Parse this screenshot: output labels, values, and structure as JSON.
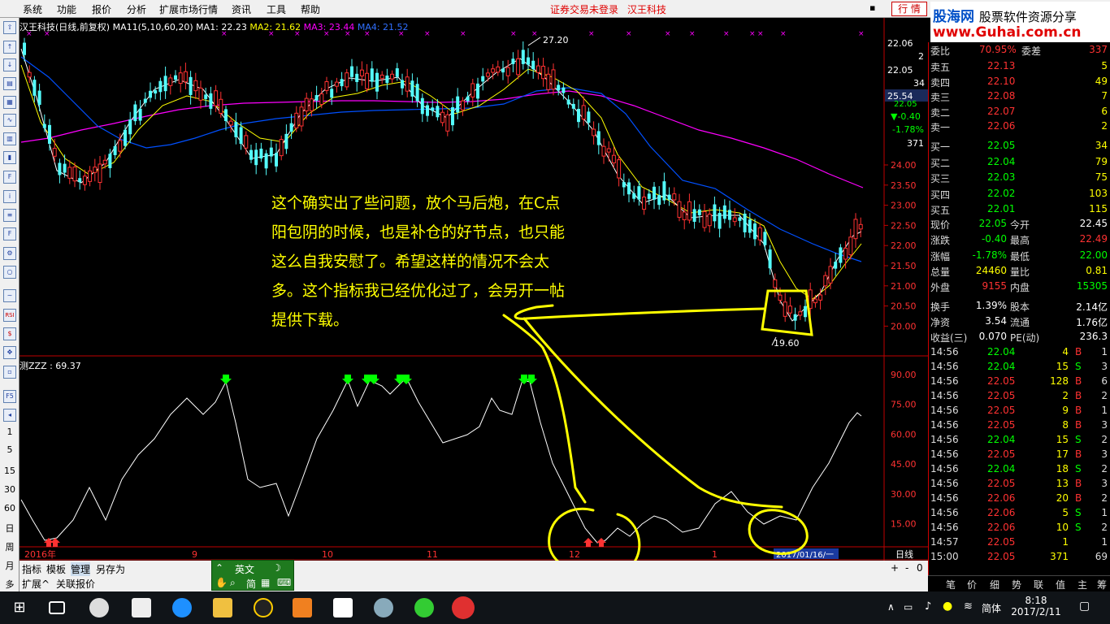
{
  "menu": {
    "items": [
      "系统",
      "功能",
      "报价",
      "分析",
      "扩展市场行情",
      "资讯",
      "工具",
      "帮助"
    ],
    "login_status": "证券交易未登录",
    "stock_name": "汉王科技",
    "quote_button": "行 情"
  },
  "logo": {
    "brand": "股海网",
    "slogan": "股票软件资源分享",
    "url": "www.Guhai.com.cn"
  },
  "chart": {
    "title_prefix": "汉王科技(日线,前复权)",
    "ma11": "MA11(5,10,60,20)",
    "ma1": "MA1: 22.23",
    "ma2": "MA2: 21.62",
    "ma3": "MA3: 23.44",
    "ma4": "MA4: 21.52",
    "high_label": "27.20",
    "low_label": "19.60",
    "price_axis": [
      "24.00",
      "23.50",
      "23.00",
      "22.50",
      "22.00",
      "21.50",
      "21.00",
      "20.50",
      "20.00"
    ],
    "current_price_tag": "25.54",
    "sub_title": "测ZZZ : 69.37",
    "sub_axis": [
      "90.00",
      "75.00",
      "60.00",
      "45.00",
      "30.00",
      "15.00"
    ],
    "date_labels": [
      "2016年",
      "9",
      "10",
      "11",
      "12",
      "1",
      "2017/01/16/一"
    ],
    "period": "日线",
    "colors": {
      "up": "#ff3232",
      "down": "#54fcfc",
      "ma1": "#ffffff",
      "ma2": "#ffff00",
      "ma3": "#ff00ff",
      "ma4": "#0050ff",
      "annotation": "#ffff00"
    }
  },
  "top_axis": {
    "v1": "22.06",
    "v1b": "2",
    "v2": "22.05",
    "v2b": "34",
    "v3": "22.05",
    "chg": "▼-0.40",
    "pct": "-1.78%",
    "vol": "371"
  },
  "order_book": {
    "ratio_label": "委比",
    "ratio": "70.95%",
    "diff_label": "委差",
    "diff": "337",
    "asks": [
      {
        "label": "卖五",
        "price": "22.13",
        "vol": "5"
      },
      {
        "label": "卖四",
        "price": "22.10",
        "vol": "49"
      },
      {
        "label": "卖三",
        "price": "22.08",
        "vol": "7"
      },
      {
        "label": "卖二",
        "price": "22.07",
        "vol": "6"
      },
      {
        "label": "卖一",
        "price": "22.06",
        "vol": "2"
      }
    ],
    "bids": [
      {
        "label": "买一",
        "price": "22.05",
        "vol": "34"
      },
      {
        "label": "买二",
        "price": "22.04",
        "vol": "79"
      },
      {
        "label": "买三",
        "price": "22.03",
        "vol": "75"
      },
      {
        "label": "买四",
        "price": "22.02",
        "vol": "103"
      },
      {
        "label": "买五",
        "price": "22.01",
        "vol": "115"
      }
    ]
  },
  "stats": [
    {
      "l1": "现价",
      "v1": "22.05",
      "c1": "#00ff00",
      "l2": "今开",
      "v2": "22.45",
      "c2": "#ffffff"
    },
    {
      "l1": "涨跌",
      "v1": "-0.40",
      "c1": "#00ff00",
      "l2": "最高",
      "v2": "22.49",
      "c2": "#ff3232"
    },
    {
      "l1": "涨幅",
      "v1": "-1.78%",
      "c1": "#00ff00",
      "l2": "最低",
      "v2": "22.00",
      "c2": "#00ff00"
    },
    {
      "l1": "总量",
      "v1": "24460",
      "c1": "#ffff00",
      "l2": "量比",
      "v2": "0.81",
      "c2": "#ffff00"
    },
    {
      "l1": "外盘",
      "v1": "9155",
      "c1": "#ff3232",
      "l2": "内盘",
      "v2": "15305",
      "c2": "#00ff00"
    },
    {
      "l1": "换手",
      "v1": "1.39%",
      "c1": "#ffffff",
      "l2": "股本",
      "v2": "2.14亿",
      "c2": "#ffffff"
    },
    {
      "l1": "净资",
      "v1": "3.54",
      "c1": "#ffffff",
      "l2": "流通",
      "v2": "1.76亿",
      "c2": "#ffffff"
    },
    {
      "l1": "收益(三)",
      "v1": "0.070",
      "c1": "#ffffff",
      "l2": "PE(动)",
      "v2": "236.3",
      "c2": "#ffffff"
    }
  ],
  "ticks": [
    {
      "t": "14:56",
      "p": "22.04",
      "v": "4",
      "s": "B",
      "n": "1"
    },
    {
      "t": "14:56",
      "p": "22.04",
      "v": "15",
      "s": "S",
      "n": "3"
    },
    {
      "t": "14:56",
      "p": "22.05",
      "v": "128",
      "s": "B",
      "n": "6"
    },
    {
      "t": "14:56",
      "p": "22.05",
      "v": "2",
      "s": "B",
      "n": "2"
    },
    {
      "t": "14:56",
      "p": "22.05",
      "v": "9",
      "s": "B",
      "n": "1"
    },
    {
      "t": "14:56",
      "p": "22.05",
      "v": "8",
      "s": "B",
      "n": "3"
    },
    {
      "t": "14:56",
      "p": "22.04",
      "v": "15",
      "s": "S",
      "n": "2"
    },
    {
      "t": "14:56",
      "p": "22.05",
      "v": "17",
      "s": "B",
      "n": "3"
    },
    {
      "t": "14:56",
      "p": "22.04",
      "v": "18",
      "s": "S",
      "n": "2"
    },
    {
      "t": "14:56",
      "p": "22.05",
      "v": "13",
      "s": "B",
      "n": "3"
    },
    {
      "t": "14:56",
      "p": "22.06",
      "v": "20",
      "s": "B",
      "n": "2"
    },
    {
      "t": "14:56",
      "p": "22.06",
      "v": "5",
      "s": "S",
      "n": "1"
    },
    {
      "t": "14:56",
      "p": "22.06",
      "v": "10",
      "s": "S",
      "n": "2"
    },
    {
      "t": "14:57",
      "p": "22.05",
      "v": "1",
      "s": "",
      "n": "1"
    },
    {
      "t": "15:00",
      "p": "22.05",
      "v": "371",
      "s": "",
      "n": "69"
    }
  ],
  "right_tabs": [
    "笔",
    "价",
    "细",
    "势",
    "联",
    "值",
    "主",
    "筹"
  ],
  "bottom_tabs": [
    "指标",
    "模板",
    "管理",
    "另存为"
  ],
  "bottom_tabs2": [
    "扩展^",
    "关联报价"
  ],
  "ime": {
    "lang": "英文",
    "mode": "简"
  },
  "toolbar_labels": [
    "1",
    "5",
    "15",
    "30",
    "60",
    "日",
    "周",
    "月",
    "多"
  ],
  "annotation": "这个确实出了些问题，放个马后炮，在C点阳包阴的时候，也是补仓的好节点，也只能这么自我安慰了。希望这样的情况不会太多。这个指标我已经优化过了，会另开一帖提供下载。",
  "taskbar": {
    "time": "8:18",
    "date": "2017/2/11",
    "ime": "简体"
  }
}
